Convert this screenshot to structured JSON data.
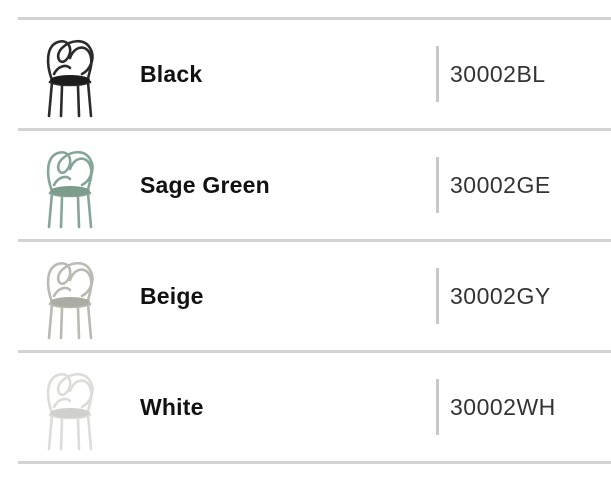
{
  "variants": [
    {
      "name": "Black",
      "code": "30002BL",
      "chair_color": "#2b2b2b",
      "seat_color": "#1c1c1c"
    },
    {
      "name": "Sage Green",
      "code": "30002GE",
      "chair_color": "#86a596",
      "seat_color": "#7c9c8c"
    },
    {
      "name": "Beige",
      "code": "30002GY",
      "chair_color": "#b9bab2",
      "seat_color": "#abada4"
    },
    {
      "name": "White",
      "code": "30002WH",
      "chair_color": "#dcddd8",
      "seat_color": "#cfd0cb"
    }
  ]
}
